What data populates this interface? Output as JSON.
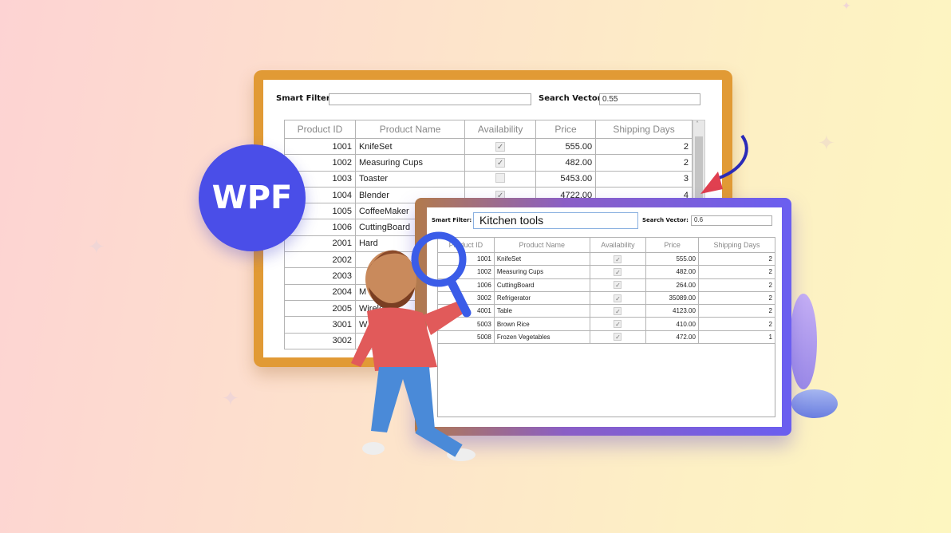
{
  "badge": {
    "label": "WPF",
    "color": "#4a4ee8"
  },
  "back_window": {
    "smart_filter_label": "Smart Filter:",
    "smart_filter_value": "",
    "search_vector_label": "Search Vector:",
    "search_vector_value": "0.55",
    "columns": [
      "Product ID",
      "Product Name",
      "Availability",
      "Price",
      "Shipping Days"
    ],
    "rows": [
      {
        "id": "1001",
        "name": "KnifeSet",
        "available": true,
        "price": "555.00",
        "days": "2"
      },
      {
        "id": "1002",
        "name": "Measuring Cups",
        "available": true,
        "price": "482.00",
        "days": "2"
      },
      {
        "id": "1003",
        "name": "Toaster",
        "available": false,
        "price": "5453.00",
        "days": "3"
      },
      {
        "id": "1004",
        "name": "Blender",
        "available": true,
        "price": "4722.00",
        "days": "4"
      },
      {
        "id": "1005",
        "name": "CoffeeMaker"
      },
      {
        "id": "1006",
        "name": "CuttingBoard"
      },
      {
        "id": "2001",
        "name": "Hard"
      },
      {
        "id": "2002",
        "name": ""
      },
      {
        "id": "2003",
        "name": ""
      },
      {
        "id": "2004",
        "name": "M"
      },
      {
        "id": "2005",
        "name": "Wireles"
      },
      {
        "id": "3001",
        "name": "W"
      },
      {
        "id": "3002",
        "name": ""
      }
    ]
  },
  "front_window": {
    "smart_filter_label": "Smart Filter:",
    "smart_filter_value": "Kitchen tools",
    "search_vector_label": "Search Vector:",
    "search_vector_value": "0.6",
    "columns": [
      "Product ID",
      "Product Name",
      "Availability",
      "Price",
      "Shipping Days"
    ],
    "rows": [
      {
        "id": "1001",
        "name": "KnifeSet",
        "available": true,
        "price": "555.00",
        "days": "2"
      },
      {
        "id": "1002",
        "name": "Measuring Cups",
        "available": true,
        "price": "482.00",
        "days": "2"
      },
      {
        "id": "1006",
        "name": "CuttingBoard",
        "available": true,
        "price": "264.00",
        "days": "2"
      },
      {
        "id": "3002",
        "name": "Refrigerator",
        "available": true,
        "price": "35089.00",
        "days": "2"
      },
      {
        "id": "4001",
        "name": "Table",
        "available": true,
        "price": "4123.00",
        "days": "2"
      },
      {
        "id": "5003",
        "name": "Brown Rice",
        "available": true,
        "price": "410.00",
        "days": "2"
      },
      {
        "id": "5008",
        "name": "Frozen Vegetables",
        "available": true,
        "price": "472.00",
        "days": "1"
      }
    ]
  }
}
